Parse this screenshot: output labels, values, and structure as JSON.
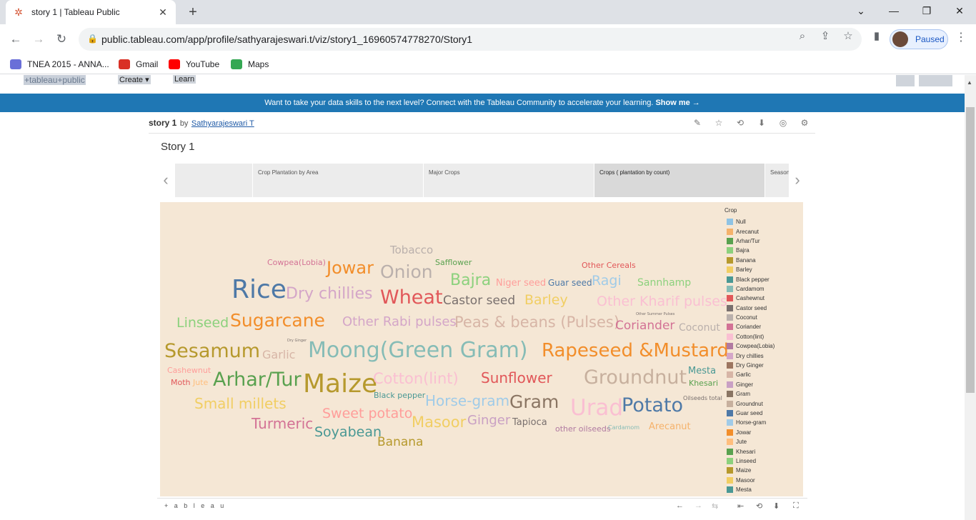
{
  "browser": {
    "tab_title": "story 1 | Tableau Public",
    "tab_close": "✕",
    "new_tab": "+",
    "url": "public.tableau.com/app/profile/sathyarajeswari.t/viz/story1_16960574778270/Story1",
    "profile_status": "Paused",
    "window_controls": [
      "⌄",
      "—",
      "❐",
      "✕"
    ],
    "bookmarks": [
      {
        "label": "TNEA 2015 - ANNA...",
        "color": "#6a6fd8"
      },
      {
        "label": "Gmail",
        "color": "#d93025"
      },
      {
        "label": "YouTube",
        "color": "#ff0000"
      },
      {
        "label": "Maps",
        "color": "#34a853"
      }
    ]
  },
  "site": {
    "logo": "+tableau+public",
    "nav": [
      "Create ▾",
      "Learn"
    ],
    "banner_text": "Want to take your data skills to the next level? Connect with the Tableau Community to accelerate your learning.",
    "banner_link": "Show me →"
  },
  "viz": {
    "name": "story 1",
    "by": "by",
    "author": "Sathyarajeswari T",
    "story_title": "Story 1",
    "story_points": [
      {
        "label": "",
        "active": false
      },
      {
        "label": "Crop Plantation by Area",
        "active": false
      },
      {
        "label": "Major Crops",
        "active": false
      },
      {
        "label": "Crops ( plantation by count)",
        "active": true
      },
      {
        "label": "Season",
        "active": false
      }
    ],
    "footer_brand": "+ a b l e a u",
    "legend_title": "Crop",
    "legend": [
      {
        "name": "Null",
        "color": "#8fc3e4"
      },
      {
        "name": "Arecanut",
        "color": "#f5b26b"
      },
      {
        "name": "Arhar/Tur",
        "color": "#59a14f"
      },
      {
        "name": "Bajra",
        "color": "#8cd17d"
      },
      {
        "name": "Banana",
        "color": "#b6992d"
      },
      {
        "name": "Barley",
        "color": "#f1ce63"
      },
      {
        "name": "Black pepper",
        "color": "#499894"
      },
      {
        "name": "Cardamom",
        "color": "#86bcb6"
      },
      {
        "name": "Cashewnut",
        "color": "#e15759"
      },
      {
        "name": "Castor seed",
        "color": "#79706e"
      },
      {
        "name": "Coconut",
        "color": "#bab0ac"
      },
      {
        "name": "Coriander",
        "color": "#d37295"
      },
      {
        "name": "Cotton(lint)",
        "color": "#fabfd2"
      },
      {
        "name": "Cowpea(Lobia)",
        "color": "#b07aa1"
      },
      {
        "name": "Dry chillies",
        "color": "#d4a6c8"
      },
      {
        "name": "Dry Ginger",
        "color": "#9d7660"
      },
      {
        "name": "Garlic",
        "color": "#d7b5a6"
      },
      {
        "name": "Ginger",
        "color": "#c9a0c4"
      },
      {
        "name": "Gram",
        "color": "#8a7563"
      },
      {
        "name": "Groundnut",
        "color": "#c7b09e"
      },
      {
        "name": "Guar seed",
        "color": "#4e79a7"
      },
      {
        "name": "Horse-gram",
        "color": "#a0cbe8"
      },
      {
        "name": "Jowar",
        "color": "#f28e2b"
      },
      {
        "name": "Jute",
        "color": "#ffbe7d"
      },
      {
        "name": "Khesari",
        "color": "#59a14f"
      },
      {
        "name": "Linseed",
        "color": "#8cd17d"
      },
      {
        "name": "Maize",
        "color": "#b6992d"
      },
      {
        "name": "Masoor",
        "color": "#f1ce63"
      },
      {
        "name": "Mesta",
        "color": "#499894"
      }
    ],
    "words": [
      {
        "text": "Tobacco",
        "color": "#bab0ac"
      },
      {
        "text": "Cowpea(Lobia)",
        "color": "#d37295"
      },
      {
        "text": "Jowar",
        "color": "#f28e2b"
      },
      {
        "text": "Onion",
        "color": "#bab0ac"
      },
      {
        "text": "Safflower",
        "color": "#59a14f"
      },
      {
        "text": "Other Cereals",
        "color": "#e15759"
      },
      {
        "text": "Rice",
        "color": "#4e79a7"
      },
      {
        "text": "Dry chillies",
        "color": "#d4a6c8"
      },
      {
        "text": "Bajra",
        "color": "#8cd17d"
      },
      {
        "text": "Niger seed",
        "color": "#ff9d9a"
      },
      {
        "text": "Guar seed",
        "color": "#4e79a7"
      },
      {
        "text": "Ragi",
        "color": "#a0cbe8"
      },
      {
        "text": "Sannhamp",
        "color": "#8cd17d"
      },
      {
        "text": "Wheat",
        "color": "#e15759"
      },
      {
        "text": "Castor seed",
        "color": "#79706e"
      },
      {
        "text": "Barley",
        "color": "#f1ce63"
      },
      {
        "text": "Other Kharif pulses",
        "color": "#fabfd2"
      },
      {
        "text": "Other Summer Pulses",
        "color": "#79706e"
      },
      {
        "text": "Linseed",
        "color": "#8cd17d"
      },
      {
        "text": "Sugarcane",
        "color": "#f28e2b"
      },
      {
        "text": "Other Rabi pulses",
        "color": "#d4a6c8"
      },
      {
        "text": "Peas & beans (Pulses)",
        "color": "#d7b5a6"
      },
      {
        "text": "Coriander",
        "color": "#d37295"
      },
      {
        "text": "Coconut",
        "color": "#bab0ac"
      },
      {
        "text": "Dry Ginger",
        "color": "#79706e"
      },
      {
        "text": "Sesamum",
        "color": "#b6992d"
      },
      {
        "text": "Garlic",
        "color": "#d7b5a6"
      },
      {
        "text": "Moong(Green Gram)",
        "color": "#86bcb6"
      },
      {
        "text": "Rapeseed &Mustard",
        "color": "#f28e2b"
      },
      {
        "text": "Cashewnut",
        "color": "#ff9d9a"
      },
      {
        "text": "Arhar/Tur",
        "color": "#59a14f"
      },
      {
        "text": "Maize",
        "color": "#b6992d"
      },
      {
        "text": "Cotton(lint)",
        "color": "#fabfd2"
      },
      {
        "text": "Sunflower",
        "color": "#e15759"
      },
      {
        "text": "Groundnut",
        "color": "#c7b09e"
      },
      {
        "text": "Mesta",
        "color": "#499894"
      },
      {
        "text": "Moth",
        "color": "#e15759"
      },
      {
        "text": "Jute",
        "color": "#ffbe7d"
      },
      {
        "text": "Khesari",
        "color": "#59a14f"
      },
      {
        "text": "Black pepper",
        "color": "#499894"
      },
      {
        "text": "Small millets",
        "color": "#f1ce63"
      },
      {
        "text": "Horse-gram",
        "color": "#a0cbe8"
      },
      {
        "text": "Gram",
        "color": "#8a7563"
      },
      {
        "text": "Urad",
        "color": "#fabfd2"
      },
      {
        "text": "Potato",
        "color": "#4e79a7"
      },
      {
        "text": "Oilseeds total",
        "color": "#79706e"
      },
      {
        "text": "Sweet potato",
        "color": "#ff9d9a"
      },
      {
        "text": "Turmeric",
        "color": "#d37295"
      },
      {
        "text": "Masoor",
        "color": "#f1ce63"
      },
      {
        "text": "Ginger",
        "color": "#c9a0c4"
      },
      {
        "text": "Tapioca",
        "color": "#79706e"
      },
      {
        "text": "other oilseeds",
        "color": "#b07aa1"
      },
      {
        "text": "Cardamom",
        "color": "#86bcb6"
      },
      {
        "text": "Arecanut",
        "color": "#f5b26b"
      },
      {
        "text": "Soyabean",
        "color": "#499894"
      },
      {
        "text": "Banana",
        "color": "#b6992d"
      }
    ]
  }
}
